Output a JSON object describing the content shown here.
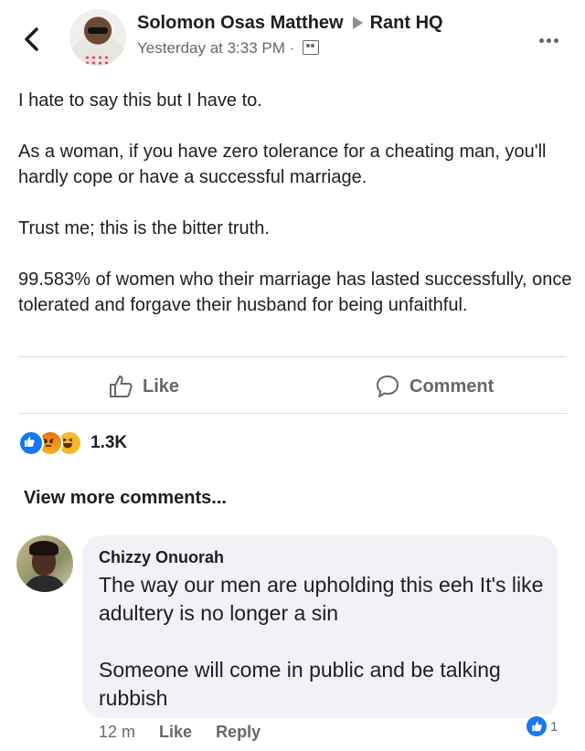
{
  "header": {
    "author": "Solomon Osas Matthew",
    "group": "Rant HQ",
    "timestamp": "Yesterday at 3:33 PM",
    "separator": "·"
  },
  "post": {
    "paragraphs": [
      "I hate to say this but I have to.",
      "As a woman, if you have zero tolerance for a cheating man, you'll hardly cope or have a successful marriage.",
      "Trust me; this is the bitter truth.",
      "99.583% of women who their marriage has lasted successfully, once tolerated and forgave their husband for being unfaithful."
    ]
  },
  "actions": {
    "like_label": "Like",
    "comment_label": "Comment"
  },
  "reactions": {
    "count": "1.3K",
    "types": [
      "like-icon",
      "angry-icon",
      "haha-icon"
    ]
  },
  "view_more": "View more comments...",
  "comment": {
    "author": "Chizzy Onuorah",
    "paragraphs": [
      "The way our men are upholding this eeh It's like adultery is no longer a sin",
      "Someone will come in public and be talking rubbish"
    ],
    "time": "12 m",
    "like_label": "Like",
    "reply_label": "Reply",
    "reaction_count": "1"
  },
  "colors": {
    "accent": "#1877f2",
    "muted": "#65676b",
    "bubble": "#f0f2f5"
  }
}
